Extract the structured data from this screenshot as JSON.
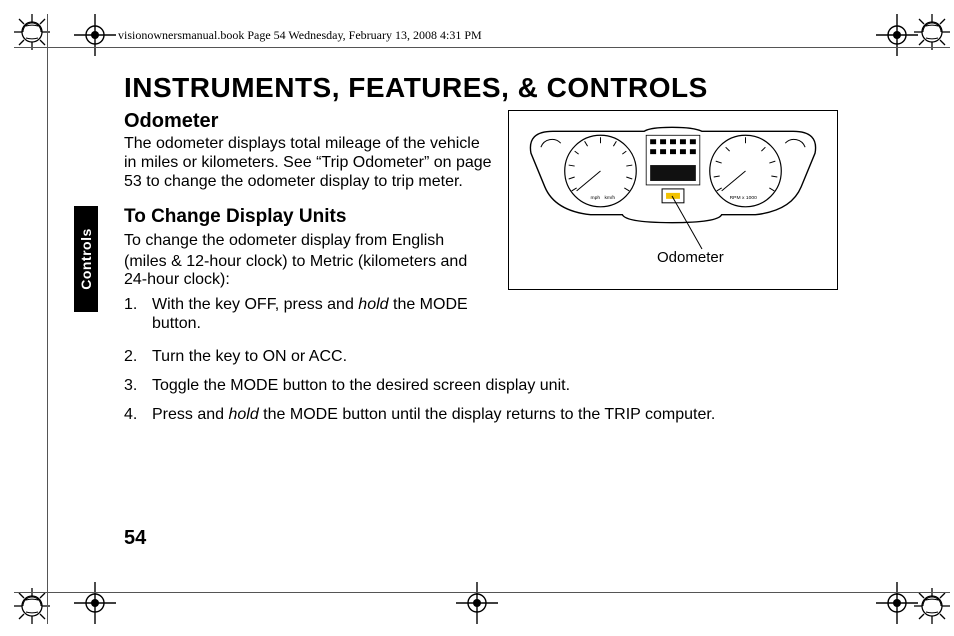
{
  "header": {
    "line": "visionownersmanual.book  Page 54  Wednesday, February 13, 2008  4:31 PM"
  },
  "sidetab": {
    "label": "Controls"
  },
  "page": {
    "number": "54"
  },
  "heading": {
    "title": "INSTRUMENTS, FEATURES, & CONTROLS",
    "section": "Odometer",
    "subsection": "To Change Display Units"
  },
  "body": {
    "intro": "The odometer displays total mileage of the vehicle in miles or kilometers. See “Trip Odometer” on page 53 to change the odometer display to trip meter.",
    "change_intro_a": "To change the odometer display from English",
    "change_intro_b": "(miles & 12-hour clock) to Metric (kilometers and 24-hour clock):"
  },
  "steps": [
    {
      "num": "1.",
      "pre": "With the key OFF, press and ",
      "em": "hold",
      "post": " the MODE button."
    },
    {
      "num": "2.",
      "pre": "Turn the key to ON or ACC.",
      "em": "",
      "post": ""
    },
    {
      "num": "3.",
      "pre": "Toggle the MODE button to the desired screen display unit.",
      "em": "",
      "post": ""
    },
    {
      "num": "4.",
      "pre": "Press and ",
      "em": "hold",
      "post": " the MODE button until the display returns to the TRIP computer."
    }
  ],
  "figure": {
    "callout": "Odometer",
    "gauge_left_unit_a": "mph",
    "gauge_left_unit_b": "km/h",
    "gauge_right_unit": "RPM x 1000"
  }
}
